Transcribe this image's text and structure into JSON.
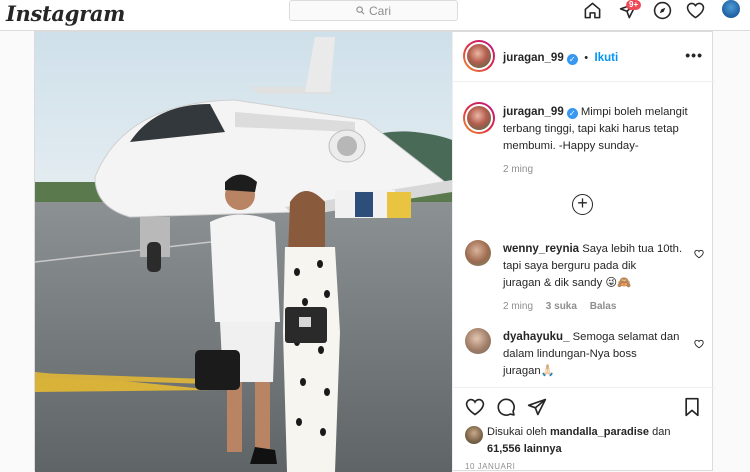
{
  "app": {
    "logo": "Instagram"
  },
  "search": {
    "placeholder": "Cari"
  },
  "nav": {
    "activity_badge": "9+"
  },
  "post": {
    "username": "juragan_99",
    "follow_label": "Ikuti",
    "separator": "•",
    "caption_lines": [
      "Mimpi boleh melangit",
      "terbang tinggi, tapi kaki harus tetap",
      "membumi. -Happy sunday-"
    ],
    "caption_time": "2 ming",
    "comments": [
      {
        "username": "wenny_reynia",
        "lines": [
          "Saya lebih tua 10th.",
          "tapi saya berguru pada dik",
          "juragan & dik sandy 😜🙈"
        ],
        "time": "2 ming",
        "likes": "3 suka",
        "reply": "Balas"
      },
      {
        "username": "dyahayuku_",
        "lines": [
          "Semoga selamat dan",
          "dalam lindungan-Nya boss",
          "juragan🙏🏻"
        ]
      }
    ],
    "liked_by_prefix": "Disukai oleh",
    "liked_by_user": "mandalla_paradise",
    "liked_by_and": "dan",
    "liked_by_count": "61,556 lainnya",
    "date": "10 JANUARI"
  }
}
